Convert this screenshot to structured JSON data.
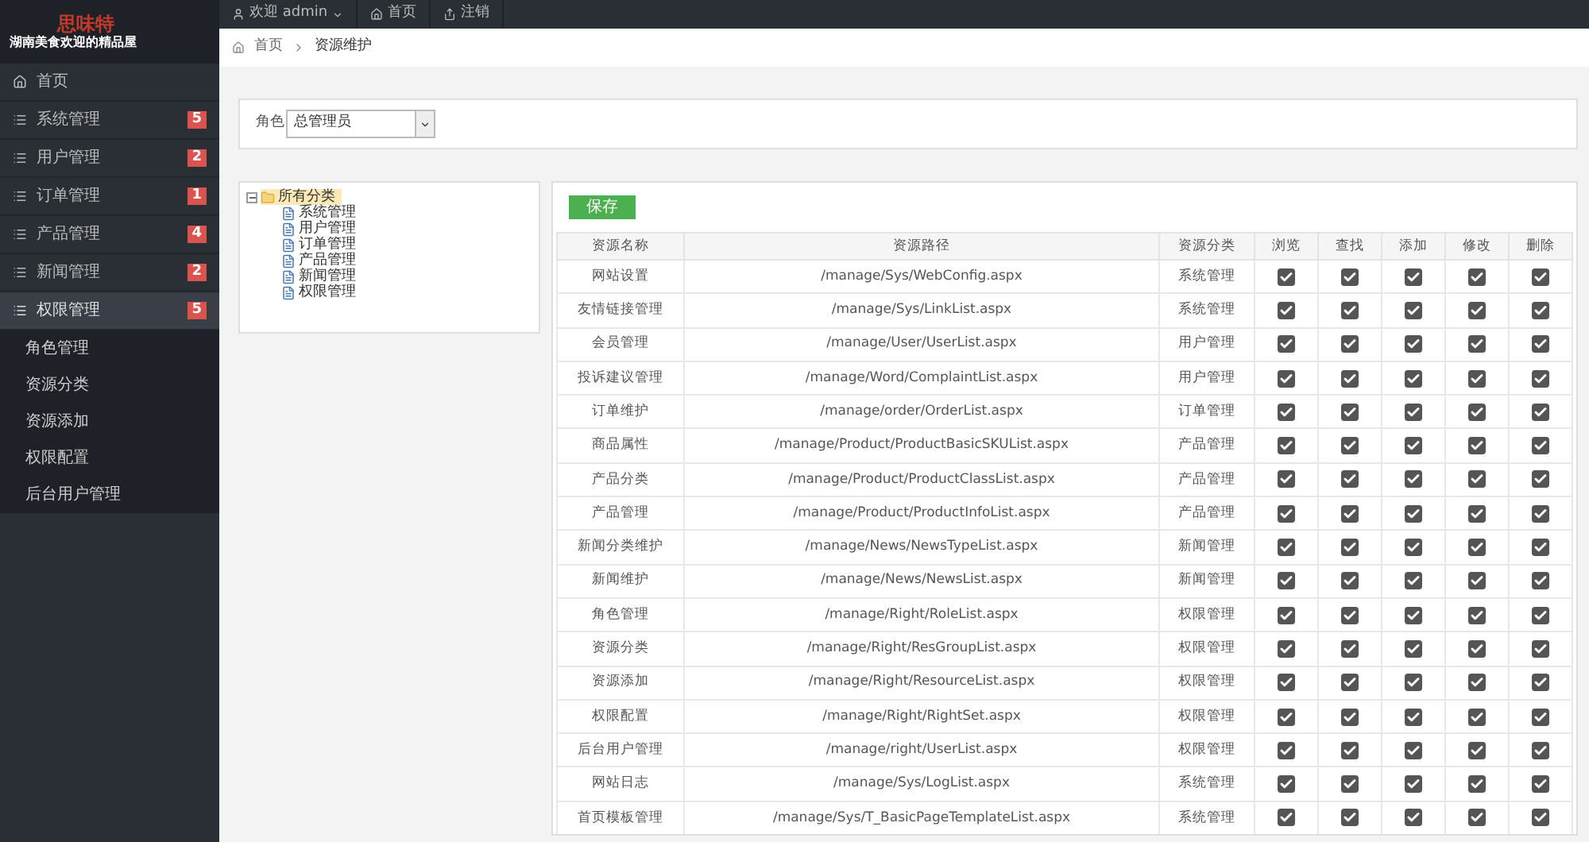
{
  "logo": {
    "title": "思味特",
    "subtitle": "湖南美食欢迎的精品屋"
  },
  "topbar": {
    "items": [
      {
        "kind": "user",
        "label": "欢迎 admin"
      },
      {
        "kind": "home",
        "label": "首页"
      },
      {
        "kind": "logout",
        "label": "注销"
      }
    ]
  },
  "breadcrumb": [
    "首页",
    "资源维护"
  ],
  "sidebar": {
    "items": [
      {
        "label": "首页",
        "kind": "home",
        "expanded": false
      },
      {
        "label": "系统管理",
        "badge": "5",
        "expanded": false
      },
      {
        "label": "用户管理",
        "badge": "2",
        "expanded": false
      },
      {
        "label": "订单管理",
        "badge": "1",
        "expanded": false
      },
      {
        "label": "产品管理",
        "badge": "4",
        "expanded": false
      },
      {
        "label": "新闻管理",
        "badge": "2",
        "expanded": false
      },
      {
        "label": "权限管理",
        "badge": "5",
        "expanded": true,
        "children": [
          {
            "label": "角色管理"
          },
          {
            "label": "资源分类"
          },
          {
            "label": "资源添加"
          },
          {
            "label": "权限配置"
          },
          {
            "label": "后台用户管理"
          }
        ]
      }
    ]
  },
  "role": {
    "label": "角色",
    "value": "总管理员"
  },
  "tree": {
    "label": "所有分类",
    "expanded": true,
    "children": [
      {
        "label": "系统管理"
      },
      {
        "label": "用户管理"
      },
      {
        "label": "订单管理"
      },
      {
        "label": "产品管理"
      },
      {
        "label": "新闻管理"
      },
      {
        "label": "权限管理"
      }
    ]
  },
  "save_button": "保存",
  "table": {
    "columns": [
      "资源名称",
      "资源路径",
      "资源分类",
      "浏览",
      "查找",
      "添加",
      "修改",
      "删除"
    ],
    "rows": [
      {
        "name": "网站设置",
        "path": "/manage/Sys/WebConfig.aspx",
        "category": "系统管理",
        "checks": [
          true,
          true,
          true,
          true,
          true
        ]
      },
      {
        "name": "友情链接管理",
        "path": "/manage/Sys/LinkList.aspx",
        "category": "系统管理",
        "checks": [
          true,
          true,
          true,
          true,
          true
        ]
      },
      {
        "name": "会员管理",
        "path": "/manage/User/UserList.aspx",
        "category": "用户管理",
        "checks": [
          true,
          true,
          true,
          true,
          true
        ]
      },
      {
        "name": "投诉建议管理",
        "path": "/manage/Word/ComplaintList.aspx",
        "category": "用户管理",
        "checks": [
          true,
          true,
          true,
          true,
          true
        ]
      },
      {
        "name": "订单维护",
        "path": "/manage/order/OrderList.aspx",
        "category": "订单管理",
        "checks": [
          true,
          true,
          true,
          true,
          true
        ]
      },
      {
        "name": "商品属性",
        "path": "/manage/Product/ProductBasicSKUList.aspx",
        "category": "产品管理",
        "checks": [
          true,
          true,
          true,
          true,
          true
        ]
      },
      {
        "name": "产品分类",
        "path": "/manage/Product/ProductClassList.aspx",
        "category": "产品管理",
        "checks": [
          true,
          true,
          true,
          true,
          true
        ]
      },
      {
        "name": "产品管理",
        "path": "/manage/Product/ProductInfoList.aspx",
        "category": "产品管理",
        "checks": [
          true,
          true,
          true,
          true,
          true
        ]
      },
      {
        "name": "新闻分类维护",
        "path": "/manage/News/NewsTypeList.aspx",
        "category": "新闻管理",
        "checks": [
          true,
          true,
          true,
          true,
          true
        ]
      },
      {
        "name": "新闻维护",
        "path": "/manage/News/NewsList.aspx",
        "category": "新闻管理",
        "checks": [
          true,
          true,
          true,
          true,
          true
        ]
      },
      {
        "name": "角色管理",
        "path": "/manage/Right/RoleList.aspx",
        "category": "权限管理",
        "checks": [
          true,
          true,
          true,
          true,
          true
        ]
      },
      {
        "name": "资源分类",
        "path": "/manage/Right/ResGroupList.aspx",
        "category": "权限管理",
        "checks": [
          true,
          true,
          true,
          true,
          true
        ]
      },
      {
        "name": "资源添加",
        "path": "/manage/Right/ResourceList.aspx",
        "category": "权限管理",
        "checks": [
          true,
          true,
          true,
          true,
          true
        ]
      },
      {
        "name": "权限配置",
        "path": "/manage/Right/RightSet.aspx",
        "category": "权限管理",
        "checks": [
          true,
          true,
          true,
          true,
          true
        ]
      },
      {
        "name": "后台用户管理",
        "path": "/manage/right/UserList.aspx",
        "category": "权限管理",
        "checks": [
          true,
          true,
          true,
          true,
          true
        ]
      },
      {
        "name": "网站日志",
        "path": "/manage/Sys/LogList.aspx",
        "category": "系统管理",
        "checks": [
          true,
          true,
          true,
          true,
          true
        ]
      },
      {
        "name": "首页模板管理",
        "path": "/manage/Sys/T_BasicPageTemplateList.aspx",
        "category": "系统管理",
        "checks": [
          true,
          true,
          true,
          true,
          true
        ]
      }
    ]
  }
}
